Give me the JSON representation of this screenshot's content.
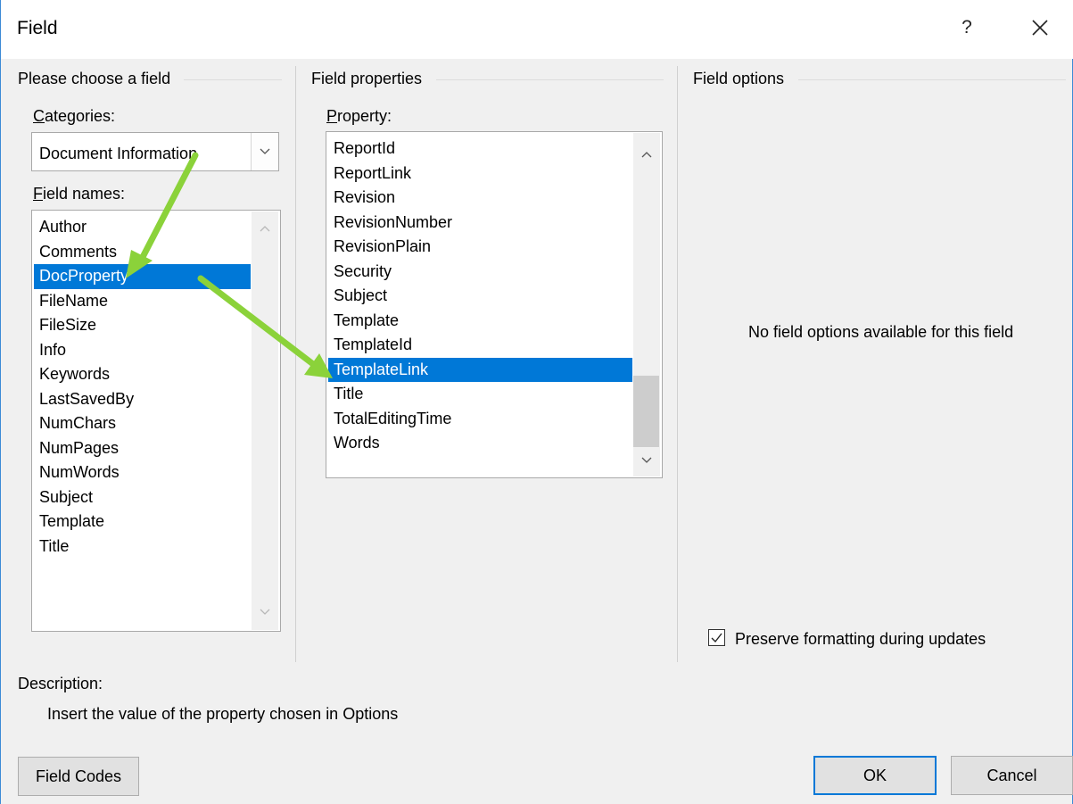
{
  "dialog": {
    "title": "Field",
    "help_label": "?",
    "close_icon": "close-icon"
  },
  "left": {
    "group_label": "Please choose a field",
    "categories_label": "Categories:",
    "categories_value": "Document Information",
    "field_names_label": "Field names:",
    "field_names": [
      "Author",
      "Comments",
      "DocProperty",
      "FileName",
      "FileSize",
      "Info",
      "Keywords",
      "LastSavedBy",
      "NumChars",
      "NumPages",
      "NumWords",
      "Subject",
      "Template",
      "Title"
    ],
    "selected_field": "DocProperty"
  },
  "middle": {
    "group_label": "Field properties",
    "property_label": "Property:",
    "properties": [
      "ReportId",
      "ReportLink",
      "Revision",
      "RevisionNumber",
      "RevisionPlain",
      "Security",
      "Subject",
      "Template",
      "TemplateId",
      "TemplateLink",
      "Title",
      "TotalEditingTime",
      "Words"
    ],
    "selected_property": "TemplateLink"
  },
  "right": {
    "group_label": "Field options",
    "empty_message": "No field options available for this field",
    "preserve_label": "Preserve formatting during updates",
    "preserve_checked": true
  },
  "description": {
    "label": "Description:",
    "text": "Insert the value of the property chosen in Options"
  },
  "buttons": {
    "field_codes": "Field Codes",
    "ok": "OK",
    "cancel": "Cancel"
  },
  "colors": {
    "selection": "#0078d7",
    "annotation_arrow": "#8bd23a"
  }
}
